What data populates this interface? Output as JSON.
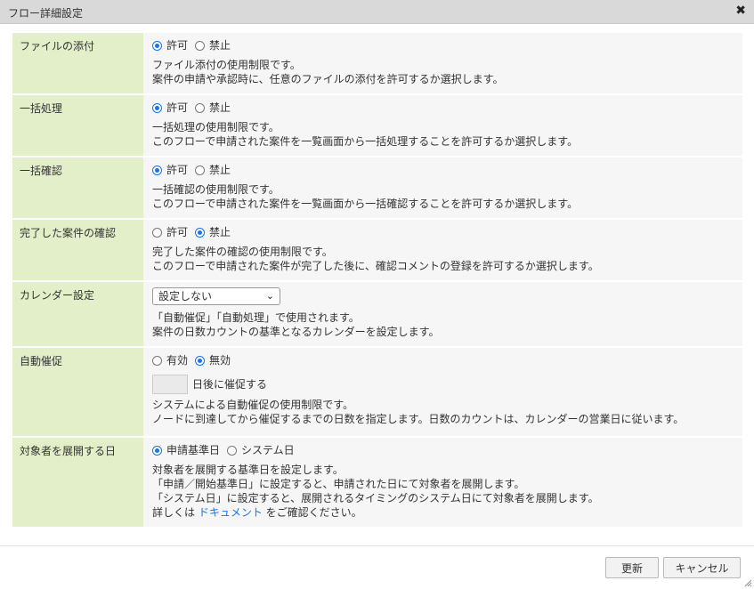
{
  "dialog": {
    "title": "フロー詳細設定",
    "close_icon": "✖"
  },
  "rows": {
    "attach": {
      "label": "ファイルの添付",
      "opt1": "許可",
      "opt2": "禁止",
      "selected": 1,
      "desc1": "ファイル添付の使用制限です。",
      "desc2": "案件の申請や承認時に、任意のファイルの添付を許可するか選択します。"
    },
    "bulk_process": {
      "label": "一括処理",
      "opt1": "許可",
      "opt2": "禁止",
      "selected": 1,
      "desc1": "一括処理の使用制限です。",
      "desc2": "このフローで申請された案件を一覧画面から一括処理することを許可するか選択します。"
    },
    "bulk_confirm": {
      "label": "一括確認",
      "opt1": "許可",
      "opt2": "禁止",
      "selected": 1,
      "desc1": "一括確認の使用制限です。",
      "desc2": "このフローで申請された案件を一覧画面から一括確認することを許可するか選択します。"
    },
    "completed_confirm": {
      "label": "完了した案件の確認",
      "opt1": "許可",
      "opt2": "禁止",
      "selected": 2,
      "desc1": "完了した案件の確認の使用制限です。",
      "desc2": "このフローで申請された案件が完了した後に、確認コメントの登録を許可するか選択します。"
    },
    "calendar": {
      "label": "カレンダー設定",
      "selected_value": "設定しない",
      "desc1": "「自動催促」「自動処理」で使用されます。",
      "desc2": "案件の日数カウントの基準となるカレンダーを設定します。"
    },
    "auto_remind": {
      "label": "自動催促",
      "opt1": "有効",
      "opt2": "無効",
      "selected": 2,
      "days_value": "",
      "days_suffix": "日後に催促する",
      "desc1": "システムによる自動催促の使用制限です。",
      "desc2": "ノードに到達してから催促するまでの日数を指定します。日数のカウントは、カレンダーの営業日に従います。"
    },
    "expand_date": {
      "label": "対象者を展開する日",
      "opt1": "申請基準日",
      "opt2": "システム日",
      "selected": 1,
      "desc1": "対象者を展開する基準日を設定します。",
      "desc2": "「申請／開始基準日」に設定すると、申請された日にて対象者を展開します。",
      "desc3": "「システム日」に設定すると、展開されるタイミングのシステム日にて対象者を展開します。",
      "desc4_pre": "詳しくは ",
      "desc4_link": "ドキュメント",
      "desc4_post": " をご確認ください。"
    }
  },
  "footer": {
    "update_label": "更新",
    "cancel_label": "キャンセル"
  },
  "colors": {
    "label_bg": "#e3efc8",
    "value_bg": "#f6f6f6",
    "accent": "#1a73e8",
    "titlebar": "#d9d9d9"
  }
}
